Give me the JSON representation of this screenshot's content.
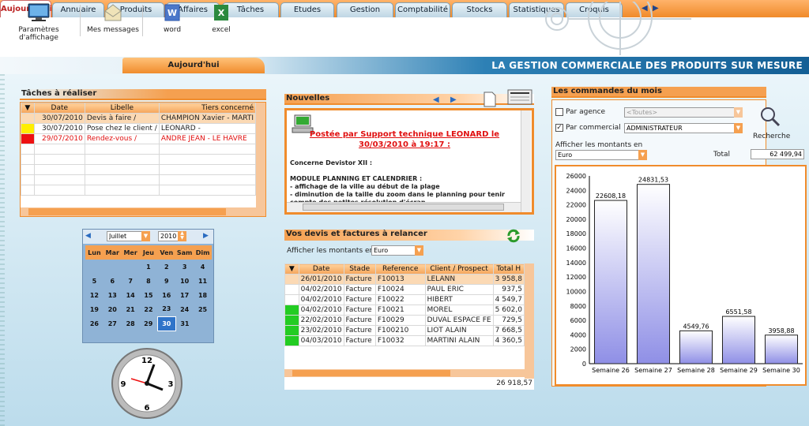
{
  "tabs": [
    "Aujourd'hui",
    "Annuaire",
    "Produits",
    "Affaires",
    "Tâches",
    "Etudes",
    "Gestion",
    "Comptabilité",
    "Stocks",
    "Statistiques",
    "Croquis"
  ],
  "toolbar": {
    "display_params": "Paramètres d'affichage",
    "messages": "Mes messages",
    "word": "word",
    "excel": "excel"
  },
  "strip": {
    "tab": "Aujourd'hui",
    "title": "LA GESTION COMMERCIALE DES PRODUITS SUR MESURE"
  },
  "tasks": {
    "title": "Tâches à réaliser",
    "columns": [
      "Date",
      "Libelle",
      "Tiers concerné"
    ],
    "rows": [
      {
        "date": "30/07/2010",
        "label": "Devis à faire /",
        "tiers": "CHAMPION Xavier - MARTI",
        "flag": "",
        "style": "hl"
      },
      {
        "date": "30/07/2010",
        "label": "Pose chez le client /",
        "tiers": "LEONARD  -",
        "flag": "#ffee00",
        "style": ""
      },
      {
        "date": "29/07/2010",
        "label": "Rendez-vous /",
        "tiers": "ANDRE JEAN - LE HAVRE",
        "flag": "#ee1111",
        "style": "red"
      }
    ]
  },
  "calendar": {
    "month": "Juillet",
    "year": "2010",
    "days": [
      "Lun",
      "Mar",
      "Mer",
      "Jeu",
      "Ven",
      "Sam",
      "Dim"
    ],
    "weeks": [
      [
        "",
        "",
        "",
        "1",
        "2",
        "3",
        "4"
      ],
      [
        "5",
        "6",
        "7",
        "8",
        "9",
        "10",
        "11"
      ],
      [
        "12",
        "13",
        "14",
        "15",
        "16",
        "17",
        "18"
      ],
      [
        "19",
        "20",
        "21",
        "22",
        "23",
        "24",
        "25"
      ],
      [
        "26",
        "27",
        "28",
        "29",
        "30",
        "31",
        ""
      ]
    ],
    "selected": "30"
  },
  "news": {
    "title": "Nouvelles",
    "headline": "Postée par Support technique LEONARD le 30/03/2010 à 19:17 :",
    "body": [
      "Concerne Devistor XII :",
      "",
      "MODULE PLANNING ET CALENDRIER :",
      "- affichage de la ville au début de la plage",
      "- diminution de la taille du zoom dans le planning pour tenir compte des petites résolution d'écran"
    ]
  },
  "quotes": {
    "title": "Vos devis et factures à relancer",
    "amount_label": "Afficher les montants en",
    "currency": "Euro",
    "columns": [
      "Date",
      "Stade",
      "Reference",
      "Client / Prospect",
      "Total H"
    ],
    "rows": [
      {
        "date": "26/01/2010",
        "stade": "Facture",
        "ref": "F10013",
        "client": "LELANN",
        "total": "3 958,8",
        "flag": "",
        "hl": true
      },
      {
        "date": "04/02/2010",
        "stade": "Facture",
        "ref": "F10024",
        "client": "PAUL ERIC",
        "total": "937,5",
        "flag": "",
        "hl": false
      },
      {
        "date": "04/02/2010",
        "stade": "Facture",
        "ref": "F10022",
        "client": "HIBERT",
        "total": "4 549,7",
        "flag": "",
        "hl": false
      },
      {
        "date": "04/02/2010",
        "stade": "Facture",
        "ref": "F10021",
        "client": "MOREL",
        "total": "5 602,0",
        "flag": "#22cc22",
        "hl": false
      },
      {
        "date": "22/02/2010",
        "stade": "Facture",
        "ref": "F10029",
        "client": "DUVAL ESPACE FE",
        "total": "729,5",
        "flag": "#22cc22",
        "hl": false
      },
      {
        "date": "23/02/2010",
        "stade": "Facture",
        "ref": "F100210",
        "client": "LIOT ALAIN",
        "total": "7 668,5",
        "flag": "#22cc22",
        "hl": false
      },
      {
        "date": "04/03/2010",
        "stade": "Facture",
        "ref": "F10032",
        "client": "MARTINI ALAIN",
        "total": "4 360,5",
        "flag": "#22cc22",
        "hl": false
      }
    ],
    "grand_total": "26 918,57"
  },
  "orders": {
    "title": "Les commandes du mois",
    "agency_label": "Par agence",
    "agency_value": "<Toutes>",
    "commercial_label": "Par commercial",
    "commercial_value": "ADMINISTRATEUR",
    "search_label": "Recherche",
    "amount_label": "Afficher les montants en",
    "currency": "Euro",
    "total_label": "Total",
    "total_value": "62 499,94"
  },
  "chart_data": {
    "type": "bar",
    "categories": [
      "Semaine 26",
      "Semaine 27",
      "Semaine 28",
      "Semaine 29",
      "Semaine 30"
    ],
    "values": [
      22608.18,
      24831.53,
      4549.76,
      6551.58,
      3958.88
    ],
    "labels": [
      "22608,18",
      "24831,53",
      "4549,76",
      "6551,58",
      "3958,88"
    ],
    "yticks": [
      0,
      2000,
      4000,
      6000,
      8000,
      10000,
      12000,
      14000,
      16000,
      18000,
      20000,
      22000,
      24000,
      26000
    ],
    "ylim": [
      0,
      26000
    ],
    "bar_color": "#8f8fe6"
  }
}
